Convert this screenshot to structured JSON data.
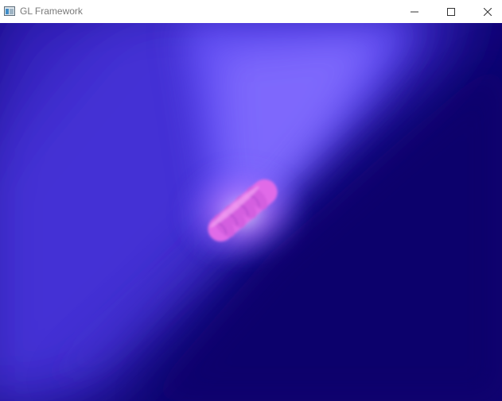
{
  "window": {
    "title": "GL Framework",
    "icon": "app-window-icon",
    "controls": {
      "minimize_icon": "minimize-icon",
      "maximize_icon": "maximize-icon",
      "close_icon": "close-icon"
    }
  },
  "scene": {
    "background_color": "#0d0372",
    "beam_color": "#5a4ff0",
    "glow_color": "#8a6cff",
    "object_color": "#e06ae8"
  }
}
